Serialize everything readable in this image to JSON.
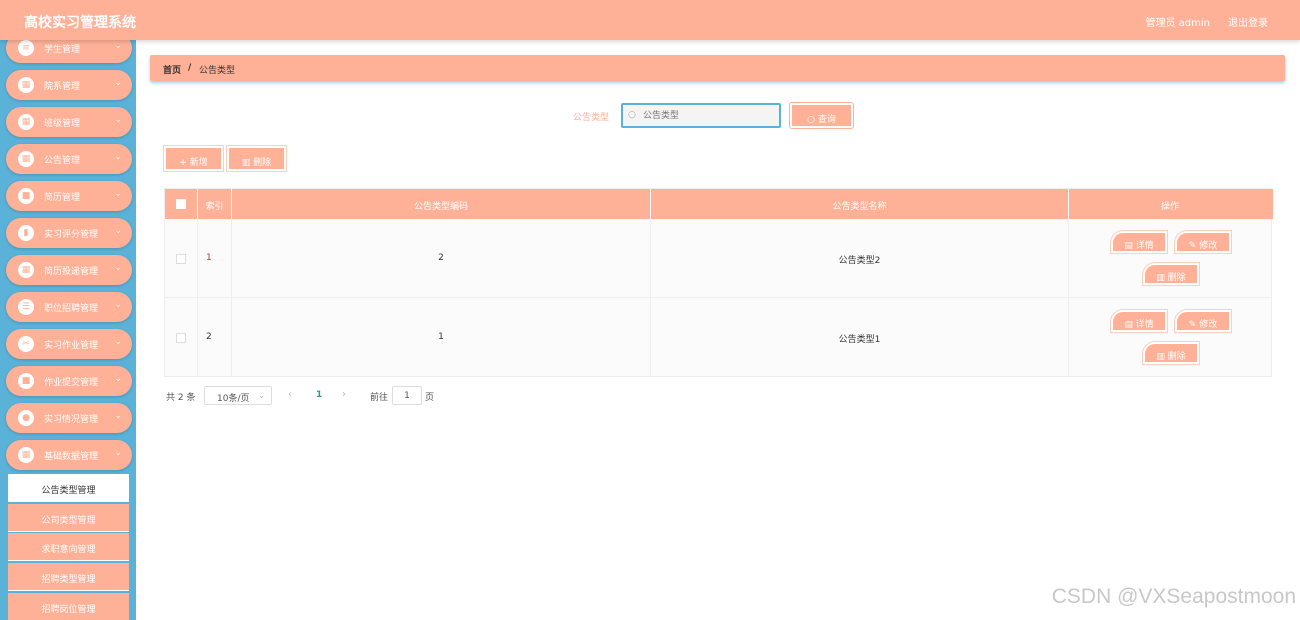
{
  "header": {
    "title": "高校实习管理系统",
    "user": "管理员 admin",
    "logout": "退出登录"
  },
  "sidebar": {
    "items": [
      {
        "label": "学生管理",
        "icon": "≡"
      },
      {
        "label": "院系管理",
        "icon": "▦"
      },
      {
        "label": "班级管理",
        "icon": "▦"
      },
      {
        "label": "公告管理",
        "icon": "▦"
      },
      {
        "label": "简历管理",
        "icon": "■"
      },
      {
        "label": "实习评分管理",
        "icon": "▮"
      },
      {
        "label": "简历投递管理",
        "icon": "▦"
      },
      {
        "label": "职位招聘管理",
        "icon": "☰"
      },
      {
        "label": "实习作业管理",
        "icon": "✂"
      },
      {
        "label": "作业提交管理",
        "icon": "■"
      },
      {
        "label": "实习情况管理",
        "icon": "●"
      },
      {
        "label": "基础数据管理",
        "icon": "▦"
      }
    ],
    "arrow": "⌄",
    "submenu": [
      {
        "label": "公告类型管理"
      },
      {
        "label": "公司类型管理"
      },
      {
        "label": "求职意向管理"
      },
      {
        "label": "招聘类型管理"
      },
      {
        "label": "招聘岗位管理"
      }
    ]
  },
  "breadcrumb": {
    "home": "首页",
    "sep": "/",
    "current": "公告类型"
  },
  "search": {
    "label": "公告类型",
    "placeholder": "公告类型",
    "icon": "○",
    "button": "○ 查询"
  },
  "toolbar": {
    "add": "+ 新增",
    "delete": "▥ 删除"
  },
  "table": {
    "headers": {
      "index": "索引",
      "code": "公告类型编码",
      "name": "公告类型名称",
      "ops": "操作"
    },
    "rows": [
      {
        "index": "1",
        "code": "2",
        "name": "公告类型2"
      },
      {
        "index": "2",
        "code": "1",
        "name": "公告类型1"
      }
    ],
    "actions": {
      "detail": "▤ 详情",
      "edit": "✎ 修改",
      "delete": "▥ 删除"
    }
  },
  "pagination": {
    "total": "共 2 条",
    "size": "10条/页",
    "size_arrow": "⌄",
    "prev": "‹",
    "page": "1",
    "next": "›",
    "goto": "前往",
    "goto_value": "1",
    "page_unit": "页"
  },
  "watermark": "CSDN @VXSeapostmoon",
  "colors": {
    "primary": "#ffb197",
    "sidebar": "#5bb2d8",
    "accent": "#20a58f"
  }
}
